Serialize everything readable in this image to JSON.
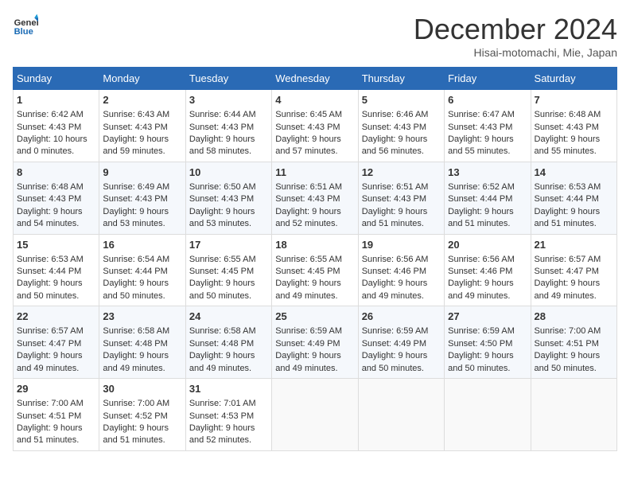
{
  "header": {
    "logo_line1": "General",
    "logo_line2": "Blue",
    "month": "December 2024",
    "location": "Hisai-motomachi, Mie, Japan"
  },
  "weekdays": [
    "Sunday",
    "Monday",
    "Tuesday",
    "Wednesday",
    "Thursday",
    "Friday",
    "Saturday"
  ],
  "weeks": [
    [
      {
        "day": "1",
        "lines": [
          "Sunrise: 6:42 AM",
          "Sunset: 4:43 PM",
          "Daylight: 10 hours",
          "and 0 minutes."
        ]
      },
      {
        "day": "2",
        "lines": [
          "Sunrise: 6:43 AM",
          "Sunset: 4:43 PM",
          "Daylight: 9 hours",
          "and 59 minutes."
        ]
      },
      {
        "day": "3",
        "lines": [
          "Sunrise: 6:44 AM",
          "Sunset: 4:43 PM",
          "Daylight: 9 hours",
          "and 58 minutes."
        ]
      },
      {
        "day": "4",
        "lines": [
          "Sunrise: 6:45 AM",
          "Sunset: 4:43 PM",
          "Daylight: 9 hours",
          "and 57 minutes."
        ]
      },
      {
        "day": "5",
        "lines": [
          "Sunrise: 6:46 AM",
          "Sunset: 4:43 PM",
          "Daylight: 9 hours",
          "and 56 minutes."
        ]
      },
      {
        "day": "6",
        "lines": [
          "Sunrise: 6:47 AM",
          "Sunset: 4:43 PM",
          "Daylight: 9 hours",
          "and 55 minutes."
        ]
      },
      {
        "day": "7",
        "lines": [
          "Sunrise: 6:48 AM",
          "Sunset: 4:43 PM",
          "Daylight: 9 hours",
          "and 55 minutes."
        ]
      }
    ],
    [
      {
        "day": "8",
        "lines": [
          "Sunrise: 6:48 AM",
          "Sunset: 4:43 PM",
          "Daylight: 9 hours",
          "and 54 minutes."
        ]
      },
      {
        "day": "9",
        "lines": [
          "Sunrise: 6:49 AM",
          "Sunset: 4:43 PM",
          "Daylight: 9 hours",
          "and 53 minutes."
        ]
      },
      {
        "day": "10",
        "lines": [
          "Sunrise: 6:50 AM",
          "Sunset: 4:43 PM",
          "Daylight: 9 hours",
          "and 53 minutes."
        ]
      },
      {
        "day": "11",
        "lines": [
          "Sunrise: 6:51 AM",
          "Sunset: 4:43 PM",
          "Daylight: 9 hours",
          "and 52 minutes."
        ]
      },
      {
        "day": "12",
        "lines": [
          "Sunrise: 6:51 AM",
          "Sunset: 4:43 PM",
          "Daylight: 9 hours",
          "and 51 minutes."
        ]
      },
      {
        "day": "13",
        "lines": [
          "Sunrise: 6:52 AM",
          "Sunset: 4:44 PM",
          "Daylight: 9 hours",
          "and 51 minutes."
        ]
      },
      {
        "day": "14",
        "lines": [
          "Sunrise: 6:53 AM",
          "Sunset: 4:44 PM",
          "Daylight: 9 hours",
          "and 51 minutes."
        ]
      }
    ],
    [
      {
        "day": "15",
        "lines": [
          "Sunrise: 6:53 AM",
          "Sunset: 4:44 PM",
          "Daylight: 9 hours",
          "and 50 minutes."
        ]
      },
      {
        "day": "16",
        "lines": [
          "Sunrise: 6:54 AM",
          "Sunset: 4:44 PM",
          "Daylight: 9 hours",
          "and 50 minutes."
        ]
      },
      {
        "day": "17",
        "lines": [
          "Sunrise: 6:55 AM",
          "Sunset: 4:45 PM",
          "Daylight: 9 hours",
          "and 50 minutes."
        ]
      },
      {
        "day": "18",
        "lines": [
          "Sunrise: 6:55 AM",
          "Sunset: 4:45 PM",
          "Daylight: 9 hours",
          "and 49 minutes."
        ]
      },
      {
        "day": "19",
        "lines": [
          "Sunrise: 6:56 AM",
          "Sunset: 4:46 PM",
          "Daylight: 9 hours",
          "and 49 minutes."
        ]
      },
      {
        "day": "20",
        "lines": [
          "Sunrise: 6:56 AM",
          "Sunset: 4:46 PM",
          "Daylight: 9 hours",
          "and 49 minutes."
        ]
      },
      {
        "day": "21",
        "lines": [
          "Sunrise: 6:57 AM",
          "Sunset: 4:47 PM",
          "Daylight: 9 hours",
          "and 49 minutes."
        ]
      }
    ],
    [
      {
        "day": "22",
        "lines": [
          "Sunrise: 6:57 AM",
          "Sunset: 4:47 PM",
          "Daylight: 9 hours",
          "and 49 minutes."
        ]
      },
      {
        "day": "23",
        "lines": [
          "Sunrise: 6:58 AM",
          "Sunset: 4:48 PM",
          "Daylight: 9 hours",
          "and 49 minutes."
        ]
      },
      {
        "day": "24",
        "lines": [
          "Sunrise: 6:58 AM",
          "Sunset: 4:48 PM",
          "Daylight: 9 hours",
          "and 49 minutes."
        ]
      },
      {
        "day": "25",
        "lines": [
          "Sunrise: 6:59 AM",
          "Sunset: 4:49 PM",
          "Daylight: 9 hours",
          "and 49 minutes."
        ]
      },
      {
        "day": "26",
        "lines": [
          "Sunrise: 6:59 AM",
          "Sunset: 4:49 PM",
          "Daylight: 9 hours",
          "and 50 minutes."
        ]
      },
      {
        "day": "27",
        "lines": [
          "Sunrise: 6:59 AM",
          "Sunset: 4:50 PM",
          "Daylight: 9 hours",
          "and 50 minutes."
        ]
      },
      {
        "day": "28",
        "lines": [
          "Sunrise: 7:00 AM",
          "Sunset: 4:51 PM",
          "Daylight: 9 hours",
          "and 50 minutes."
        ]
      }
    ],
    [
      {
        "day": "29",
        "lines": [
          "Sunrise: 7:00 AM",
          "Sunset: 4:51 PM",
          "Daylight: 9 hours",
          "and 51 minutes."
        ]
      },
      {
        "day": "30",
        "lines": [
          "Sunrise: 7:00 AM",
          "Sunset: 4:52 PM",
          "Daylight: 9 hours",
          "and 51 minutes."
        ]
      },
      {
        "day": "31",
        "lines": [
          "Sunrise: 7:01 AM",
          "Sunset: 4:53 PM",
          "Daylight: 9 hours",
          "and 52 minutes."
        ]
      },
      null,
      null,
      null,
      null
    ]
  ]
}
